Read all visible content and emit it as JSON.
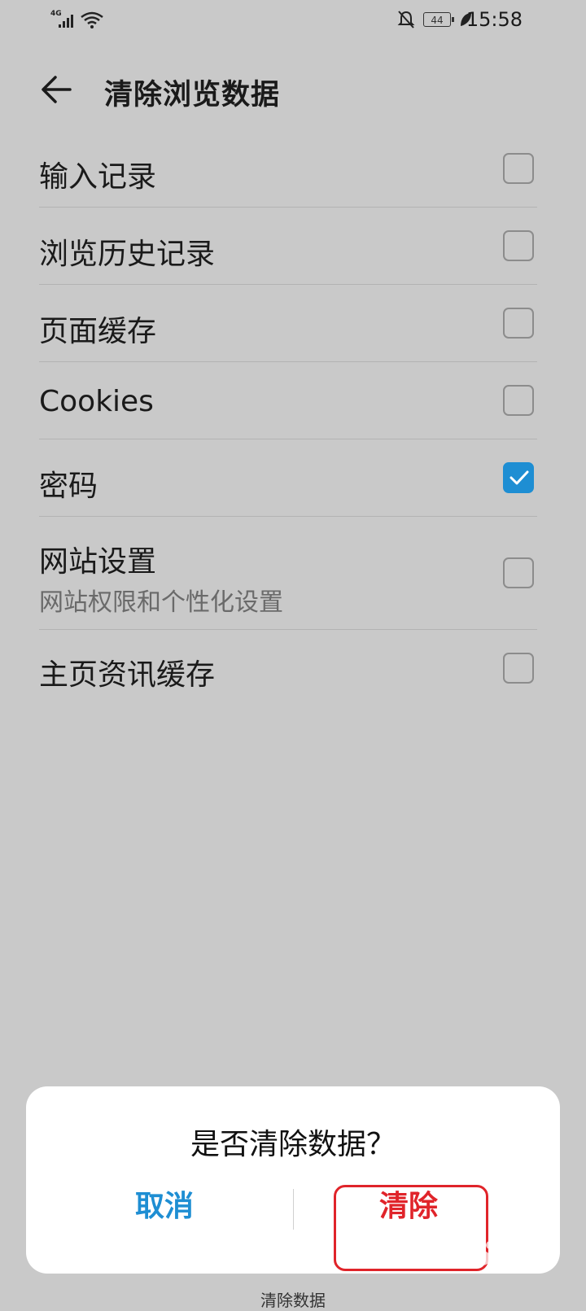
{
  "status_bar": {
    "network": "4G",
    "battery": "44",
    "time": "15:58"
  },
  "header": {
    "title": "清除浏览数据"
  },
  "options": [
    {
      "label": "输入记录",
      "sublabel": "",
      "checked": false
    },
    {
      "label": "浏览历史记录",
      "sublabel": "",
      "checked": false
    },
    {
      "label": "页面缓存",
      "sublabel": "",
      "checked": false
    },
    {
      "label": "Cookies",
      "sublabel": "",
      "checked": false
    },
    {
      "label": "密码",
      "sublabel": "",
      "checked": true
    },
    {
      "label": "网站设置",
      "sublabel": "网站权限和个性化设置",
      "checked": false
    },
    {
      "label": "主页资讯缓存",
      "sublabel": "",
      "checked": false
    }
  ],
  "dialog": {
    "message": "是否清除数据？",
    "cancel_label": "取消",
    "confirm_label": "清除"
  },
  "behind_button_label": "清除数据",
  "colors": {
    "accent_blue": "#1e8ed3",
    "danger_red": "#e0242a",
    "dim_background": "#c9c9c9"
  }
}
